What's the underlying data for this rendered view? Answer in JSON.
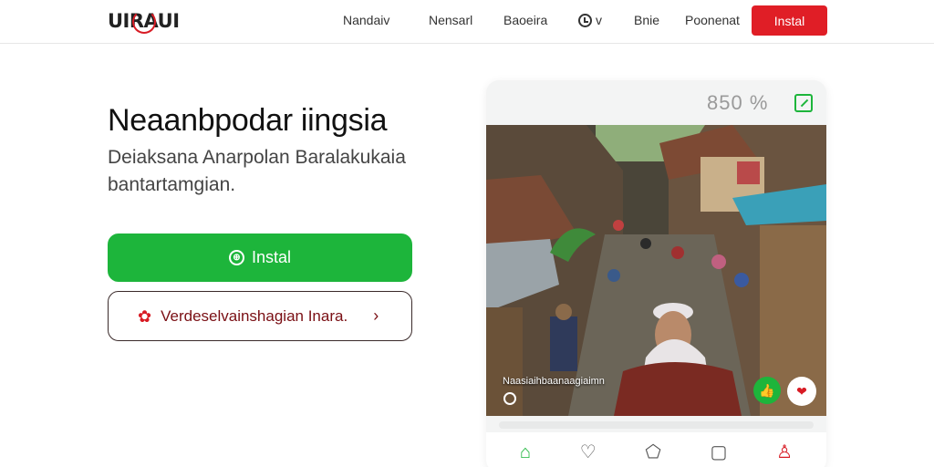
{
  "header": {
    "logo_text": "UIRAUI",
    "nav": [
      "Nandaiv",
      "Nensarl",
      "Baoeira",
      "v",
      "Bnie",
      "Poonenat"
    ],
    "install_label": "Instal"
  },
  "hero": {
    "title": "Neaanbpodar iingsia",
    "subtitle": "Deiaksana Anarpolan Baralakukaia bantartamgian.",
    "primary_button": "Instal",
    "secondary_button": "Verdeselvainshagian Inara."
  },
  "card": {
    "percent": "850 %",
    "caption": "Naasiaihbaanaagiaimn",
    "icons": {
      "edit": "edit-icon",
      "like": "thumbs-up-icon",
      "heart": "heart-icon"
    },
    "bottom_nav": [
      "home-icon",
      "heart-icon",
      "house-outline-icon",
      "box-icon",
      "user-icon"
    ]
  },
  "colors": {
    "brand_red": "#e01e26",
    "brand_green": "#1db53b"
  }
}
